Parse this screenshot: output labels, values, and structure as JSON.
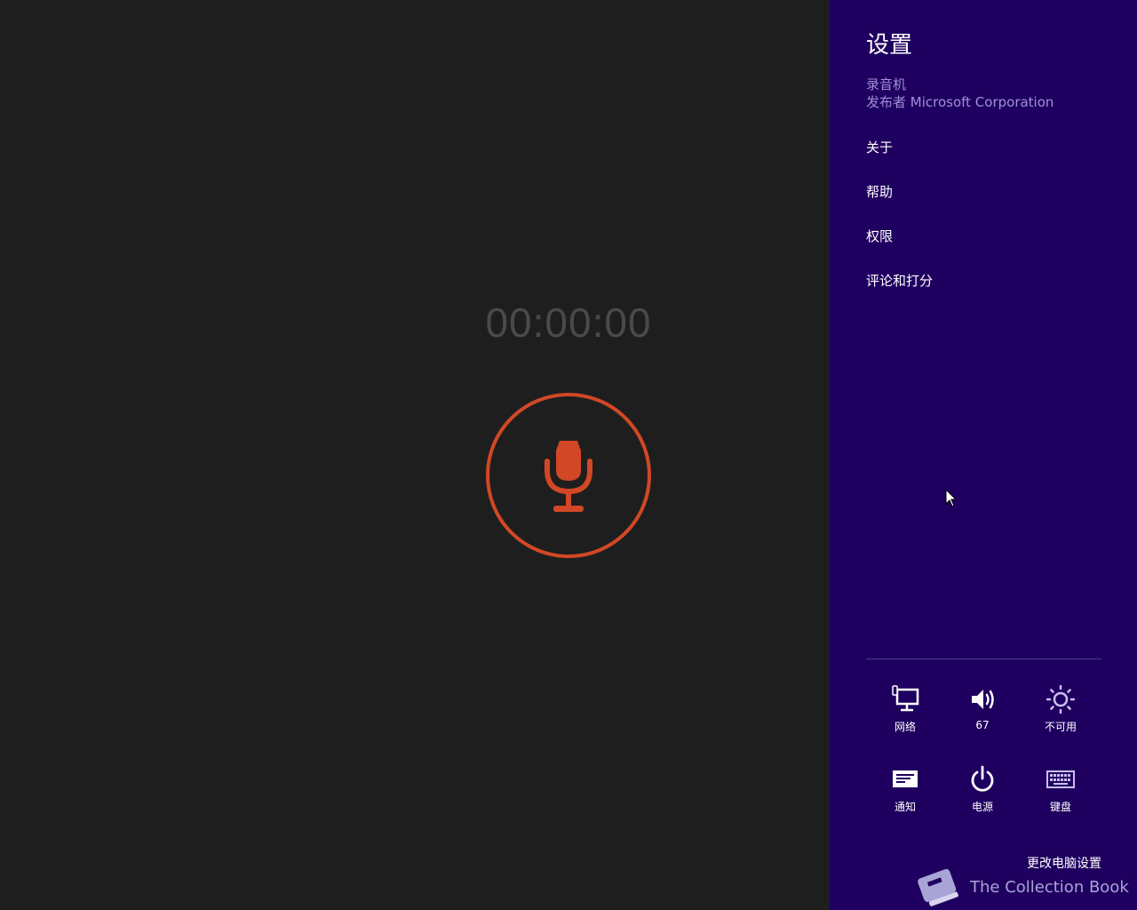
{
  "recorder": {
    "timer": "00:00:00",
    "accent_color": "#d24726"
  },
  "charm": {
    "title": "设置",
    "app_name": "录音机",
    "publisher": "发布者 Microsoft Corporation",
    "menu": [
      {
        "label": "关于"
      },
      {
        "label": "帮助"
      },
      {
        "label": "权限"
      },
      {
        "label": "评论和打分"
      }
    ],
    "quick_settings": [
      {
        "label": "网络",
        "icon": "network-icon"
      },
      {
        "label": "67",
        "icon": "volume-icon"
      },
      {
        "label": "不可用",
        "icon": "brightness-icon"
      },
      {
        "label": "通知",
        "icon": "notifications-icon"
      },
      {
        "label": "电源",
        "icon": "power-icon"
      },
      {
        "label": "键盘",
        "icon": "keyboard-icon"
      }
    ],
    "change_pc_settings": "更改电脑设置",
    "background_color": "#1f0060"
  },
  "watermark": {
    "text": "The Collection Book",
    "icon": "book-icon"
  }
}
